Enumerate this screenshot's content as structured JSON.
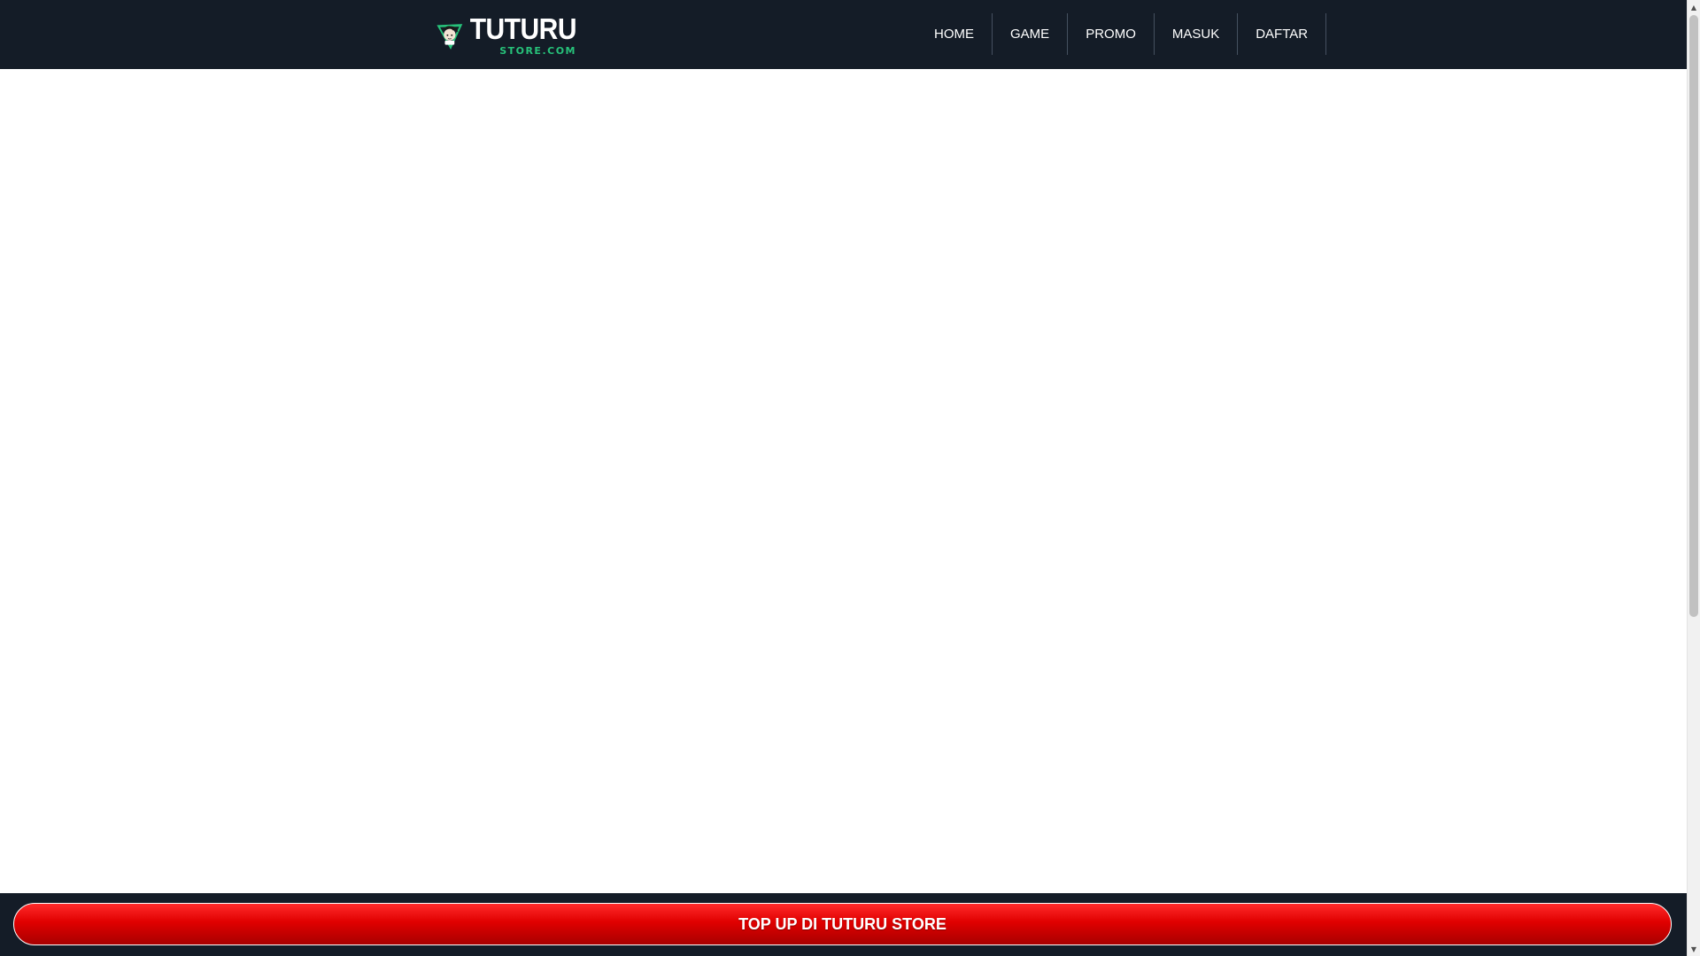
{
  "header": {
    "logo": {
      "title": "TUTURU",
      "subtitle": "STORE.COM",
      "icon": "mascot-shield-icon"
    },
    "nav": [
      {
        "label": "HOME"
      },
      {
        "label": "GAME"
      },
      {
        "label": "PROMO"
      },
      {
        "label": "MASUK"
      },
      {
        "label": "DAFTAR"
      }
    ]
  },
  "footer": {
    "cta_label": "TOP UP DI TUTURU STORE"
  },
  "colors": {
    "header_bg": "#141c27",
    "accent_green": "#27c27a",
    "cta_red": "#e00000",
    "text_white": "#ffffff"
  },
  "icons": {
    "scroll_up": "▲",
    "scroll_down": "▼"
  }
}
